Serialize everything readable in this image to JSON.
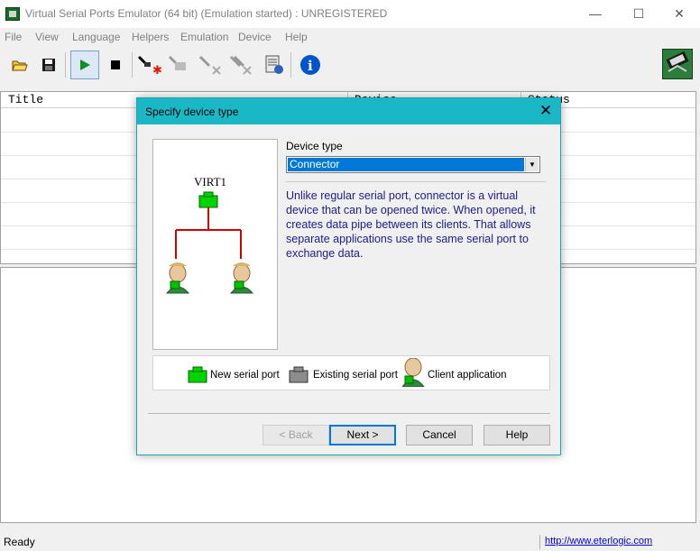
{
  "window": {
    "title": "Virtual Serial Ports Emulator (64 bit) (Emulation started) : UNREGISTERED",
    "controls": {
      "minimize": "—",
      "maximize": "☐",
      "close": "✕"
    }
  },
  "menu": [
    "File",
    "View",
    "Language",
    "Helpers",
    "Emulation",
    "Device",
    "Help"
  ],
  "toolbar": {
    "icons": [
      "open-folder-icon",
      "save-icon",
      "play-icon",
      "stop-icon",
      "new-device-icon",
      "edit-device-icon",
      "delete-device-icon",
      "remove-all-icon",
      "settings-icon",
      "info-icon",
      "serial-cable-icon"
    ]
  },
  "list": {
    "columns": [
      "Title",
      "Device",
      "Status"
    ]
  },
  "dialog": {
    "title": "Specify device type",
    "close": "✕",
    "virt_label": "VIRT1",
    "device_type_label": "Device type",
    "device_type_value": "Connector",
    "description": "Unlike regular serial port, connector is a virtual device that can be opened twice. When opened, it creates data pipe between its clients. That allows separate applications use the same serial port to exchange data.",
    "legend": [
      "New serial port",
      "Existing serial port",
      "Client application"
    ],
    "buttons": {
      "back": "< Back",
      "next": "Next >",
      "cancel": "Cancel",
      "help": "Help"
    }
  },
  "status": {
    "text": "Ready",
    "link": "http://www.eterlogic.com"
  },
  "colors": {
    "dialog_titlebar": "#1ab7c6",
    "description_text": "#1c1c8c",
    "selection": "#0078d7",
    "port_green": "#00d400",
    "wire_red": "#d40000"
  }
}
